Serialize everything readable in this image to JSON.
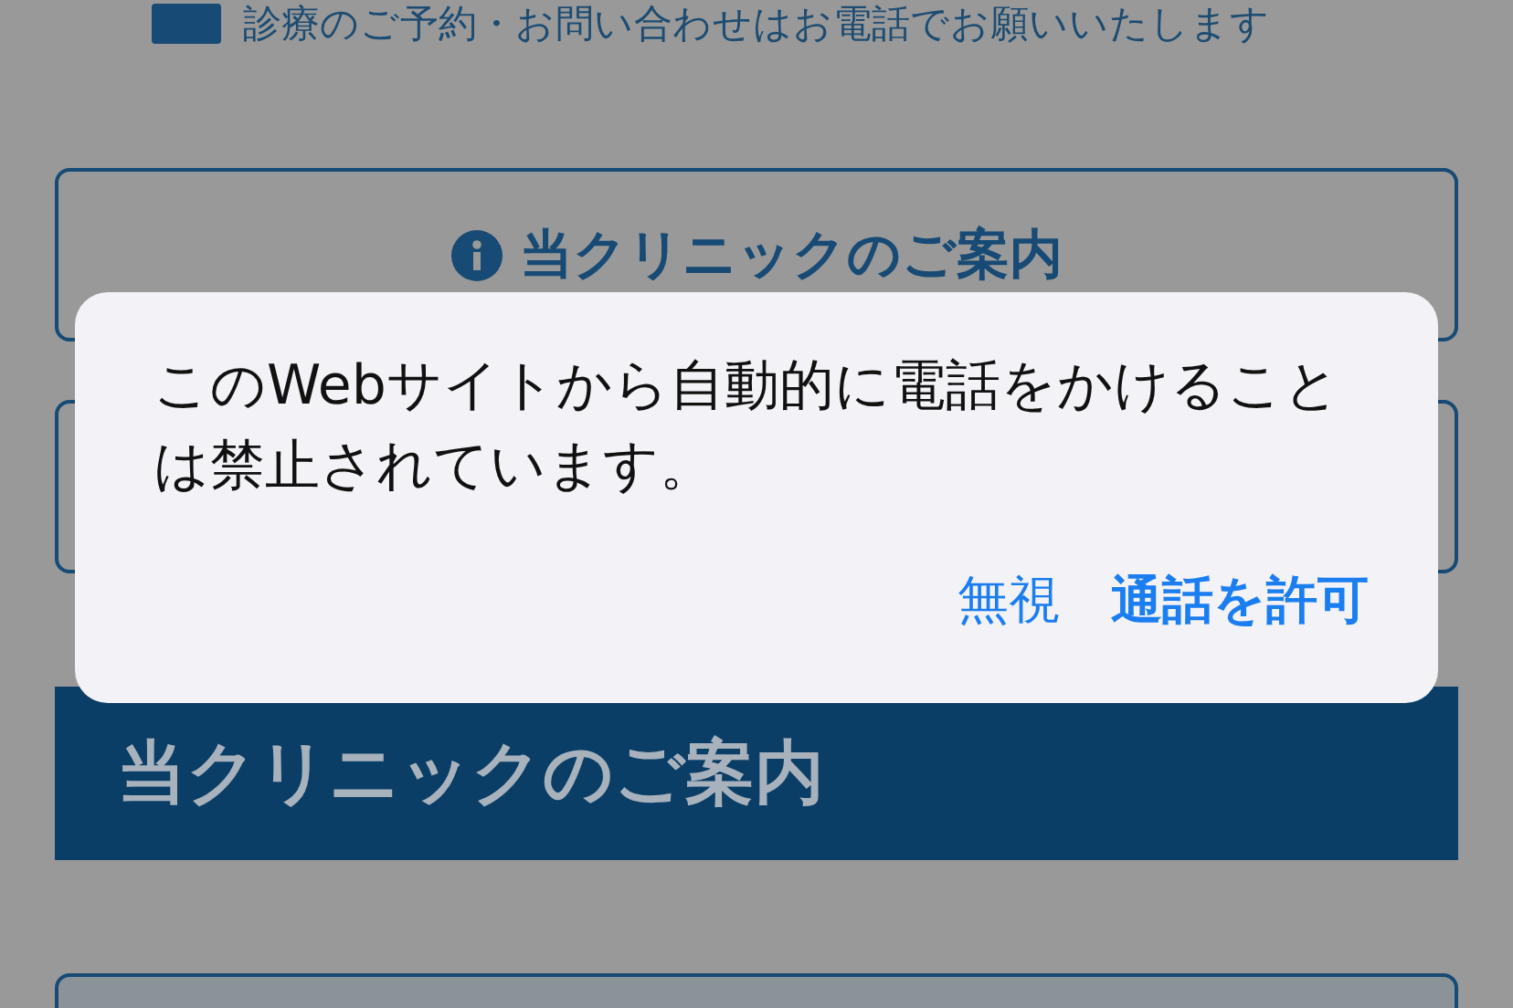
{
  "notice": {
    "text": "診療のご予約・お問い合わせはお電話でお願いいたします"
  },
  "link_buttons": [
    {
      "kind": "info",
      "label": "当クリニックのご案内"
    },
    {
      "kind": "covered"
    }
  ],
  "banner": {
    "heading": "当クリニックのご案内"
  },
  "dialog": {
    "message": "このWebサイトから自動的に電話をかけることは禁止されています。",
    "actions": [
      {
        "kind": "cancel",
        "label": "無視"
      },
      {
        "kind": "default",
        "label": "通話を許可"
      }
    ]
  }
}
